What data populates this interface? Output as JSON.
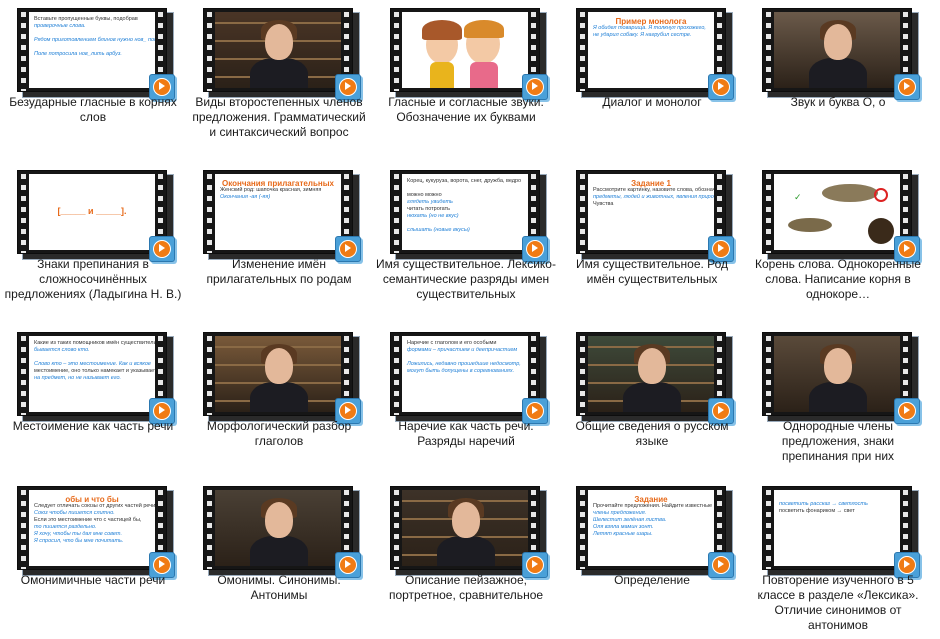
{
  "videos": [
    {
      "title": "Безударные гласные в корнях слов",
      "thumb": {
        "kind": "slide",
        "lines": [
          "Вставьте пропущенные буквы, подобрав",
          "проверочные слова.",
          "",
          "Рядом приготовлением блинов нужно нов_ пото",
          "",
          "Поле потросила нов_лить арбуз."
        ]
      }
    },
    {
      "title": "Виды второстепенных членов предложения. Грамматический и синтаксический вопрос",
      "thumb": {
        "kind": "person",
        "bg": "#4a3526"
      }
    },
    {
      "title": "Гласные и согласные звуки. Обозначение их буквами",
      "thumb": {
        "kind": "cartoon"
      }
    },
    {
      "title": "Диалог и монолог",
      "thumb": {
        "kind": "slide-title",
        "heading": "Пример монолога",
        "lines": [
          "Я обидел товарища. Я толкнул прохожего,",
          "не ударил собаку. Я нагрубил сестре."
        ]
      }
    },
    {
      "title": "Звук и буква О, о",
      "thumb": {
        "kind": "person",
        "bg": "#6b5a4a"
      }
    },
    {
      "title": "Знаки препинания в сложносочинённых предложениях (Ладыгина Н. В.)",
      "thumb": {
        "kind": "brackets",
        "text": "[_____ и _____]."
      }
    },
    {
      "title": "Изменение имён прилагательных по родам",
      "thumb": {
        "kind": "slide-title",
        "heading": "Окончания прилагательных",
        "lines": [
          "Женский род: шапочка красная, зимняя",
          "Окончания -ая (-яя)"
        ]
      }
    },
    {
      "title": "Имя существительное. Лексико-семантические разряды имен существительных",
      "thumb": {
        "kind": "slide",
        "lines": [
          "Корец, кукуруза, ворота, снег, дружба, ведро",
          "",
          "можно        можно",
          "глядеть      увидеть",
          "читать       потрогать",
          "нюхать      (но не вкус)",
          "",
          "слышать    (новые вкусы)"
        ]
      }
    },
    {
      "title": "Имя существительное. Род имён существительных",
      "thumb": {
        "kind": "slide-title",
        "heading": "Задание 1",
        "lines": [
          "Рассмотрите картинку, назовите слова, обозначающие",
          "предметы, людей и животных, явления природы, чувства.",
          "Чувства"
        ]
      }
    },
    {
      "title": "Корень слова. Однокоренные слова. Написание корня в однокоре…",
      "thumb": {
        "kind": "fish"
      }
    },
    {
      "title": "Местоимение как часть речи",
      "thumb": {
        "kind": "slide",
        "lines": [
          "Какие из таких помощников имён существительных",
          "бывается слово кто.",
          "",
          "Слово кто – это местоимение. Как и всякое",
          "местоимение, оно только намекает и указывает",
          "на предмет, но не называет его."
        ]
      }
    },
    {
      "title": "Морфологический разбор глаголов",
      "thumb": {
        "kind": "person",
        "bg": "#7a5a3a"
      }
    },
    {
      "title": "Наречие как часть речи. Разряды наречий",
      "thumb": {
        "kind": "slide",
        "lines": [
          "Наречие с глаголом и его особыми",
          "формами – причастием и деепричастием",
          "",
          "Ложились, недавно прошедшие недосмотр,",
          "могут быть допущены в соревнованиях."
        ]
      }
    },
    {
      "title": "Общие сведения о русском языке",
      "thumb": {
        "kind": "person",
        "bg": "#3e4a3a"
      }
    },
    {
      "title": "Однородные члены предложения, знаки препинания при них",
      "thumb": {
        "kind": "person",
        "bg": "#5a4a3a"
      }
    },
    {
      "title": "Омонимичные части речи",
      "thumb": {
        "kind": "slide-title",
        "heading": "обы и что бы",
        "lines": [
          "Следует отличать союзы от других частей речи.",
          "Союз чтобы пишется слитно.",
          "Если это местоимение что с частицей бы,",
          "то пишется раздельно.",
          "Я хочу, чтобы ты дал мне совет.",
          "Я спросил, что бы мне почитать."
        ]
      }
    },
    {
      "title": "Омонимы. Синонимы. Антонимы",
      "thumb": {
        "kind": "person",
        "bg": "#4a4035"
      }
    },
    {
      "title": "Описание пейзажное, портретное, сравнительное",
      "thumb": {
        "kind": "person",
        "bg": "#3d3228"
      }
    },
    {
      "title": "Определение",
      "thumb": {
        "kind": "slide-title",
        "heading": "Задание",
        "lines": [
          "Прочитайте предложения. Найдите известные вам",
          "члены предложения.",
          "Шелестит зелёная листва.",
          "Оля взяла мамин зонт.",
          "Летят красные шары."
        ]
      }
    },
    {
      "title": "Повторение изученного в 5 классе в разделе «Лексика». Отличие синонимов от антонимов",
      "thumb": {
        "kind": "slide",
        "lines": [
          "",
          "посветить рассказ  →  светлость",
          "посветить фонариком  →  свет"
        ]
      }
    }
  ],
  "colors": {
    "accent": "#f07b14",
    "play_frame": "#4aa0d8",
    "slide_heading": "#e76a1a",
    "slide_link": "#1f7fd6"
  }
}
